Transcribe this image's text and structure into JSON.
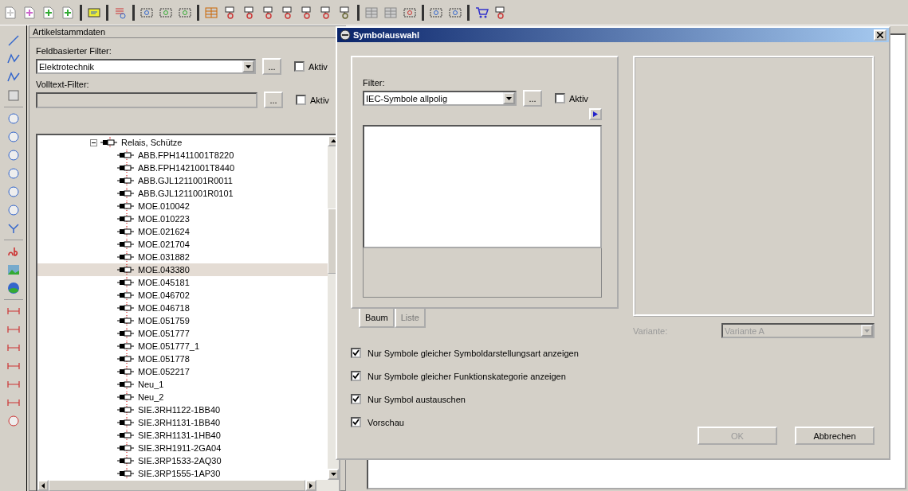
{
  "panel": {
    "title": "Artikelstammdaten",
    "field_filter": {
      "label": "Feldbasierter Filter:",
      "value": "Elektrotechnik",
      "browse": "...",
      "active_label": "Aktiv",
      "active": false
    },
    "fulltext_filter": {
      "label": "Volltext-Filter:",
      "disabled": true,
      "browse": "...",
      "active_label": "Aktiv",
      "active": false
    },
    "tree": [
      {
        "label": "Relais, Schütze",
        "expanded": true,
        "selected": false,
        "children": [
          {
            "label": "ABB.FPH1411001T8220",
            "selected": false
          },
          {
            "label": "ABB.FPH1421001T8440",
            "selected": false
          },
          {
            "label": "ABB.GJL1211001R0011",
            "selected": false
          },
          {
            "label": "ABB.GJL1211001R0101",
            "selected": false
          },
          {
            "label": "MOE.010042",
            "selected": false
          },
          {
            "label": "MOE.010223",
            "selected": false
          },
          {
            "label": "MOE.021624",
            "selected": false
          },
          {
            "label": "MOE.021704",
            "selected": false
          },
          {
            "label": "MOE.031882",
            "selected": false
          },
          {
            "label": "MOE.043380",
            "selected": true
          },
          {
            "label": "MOE.045181",
            "selected": false
          },
          {
            "label": "MOE.046702",
            "selected": false
          },
          {
            "label": "MOE.046718",
            "selected": false
          },
          {
            "label": "MOE.051759",
            "selected": false
          },
          {
            "label": "MOE.051777",
            "selected": false
          },
          {
            "label": "MOE.051777_1",
            "selected": false
          },
          {
            "label": "MOE.051778",
            "selected": false
          },
          {
            "label": "MOE.052217",
            "selected": false
          },
          {
            "label": "Neu_1",
            "selected": false
          },
          {
            "label": "Neu_2",
            "selected": false
          },
          {
            "label": "SIE.3RH1122-1BB40",
            "selected": false
          },
          {
            "label": "SIE.3RH1131-1BB40",
            "selected": false
          },
          {
            "label": "SIE.3RH1131-1HB40",
            "selected": false
          },
          {
            "label": "SIE.3RH1911-2GA04",
            "selected": false
          },
          {
            "label": "SIE.3RP1533-2AQ30",
            "selected": false
          },
          {
            "label": "SIE.3RP1555-1AP30",
            "selected": false
          }
        ]
      }
    ]
  },
  "dialog": {
    "title": "Symbolauswahl",
    "filter_label": "Filter:",
    "filter_value": "IEC-Symbole allpolig",
    "browse": "...",
    "active_label": "Aktiv",
    "active": false,
    "tabs": [
      {
        "label": "Baum",
        "selected": true
      },
      {
        "label": "Liste",
        "selected": false
      }
    ],
    "options": [
      {
        "label": "Nur Symbole gleicher Symboldarstellungsart anzeigen",
        "checked": true
      },
      {
        "label": "Nur Symbole gleicher Funktionskategorie anzeigen",
        "checked": true
      },
      {
        "label": "Nur Symbol austauschen",
        "checked": true
      },
      {
        "label": "Vorschau",
        "checked": true
      }
    ],
    "variant_label": "Variante:",
    "variant_value": "Variante A",
    "variant_disabled": true,
    "ok": {
      "label": "OK",
      "disabled": true
    },
    "cancel": {
      "label": "Abbrechen",
      "disabled": false
    }
  }
}
